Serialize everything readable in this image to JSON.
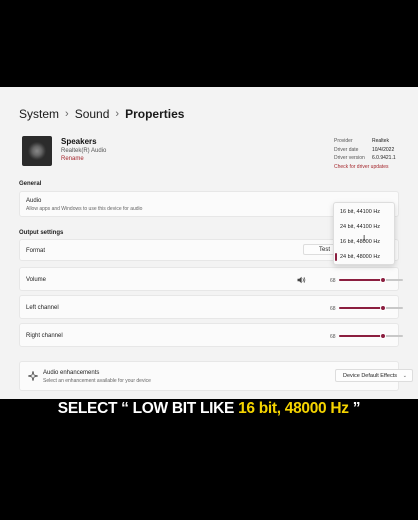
{
  "breadcrumb": {
    "item1": "System",
    "item2": "Sound",
    "current": "Properties"
  },
  "device": {
    "name": "Speakers",
    "subtitle": "Realtek(R) Audio",
    "rename_label": "Rename"
  },
  "info": {
    "provider_label": "Provider",
    "provider_value": "Realtek",
    "date_label": "Driver date",
    "date_value": "10/4/2022",
    "version_label": "Driver version",
    "version_value": "6.0.9421.1",
    "update_link": "Check for driver updates"
  },
  "general": {
    "heading": "General",
    "audio_title": "Audio",
    "audio_desc": "Allow apps and Windows to use this device for audio"
  },
  "output": {
    "heading": "Output settings",
    "format_label": "Format",
    "test_label": "Test",
    "format_options": [
      "16 bit, 44100 Hz",
      "24 bit, 44100 Hz",
      "16 bit, 48000 Hz",
      "24 bit, 48000 Hz"
    ],
    "selected_index": 3,
    "volume_label": "Volume",
    "volume_value": 68,
    "left_label": "Left channel",
    "left_value": 68,
    "right_label": "Right channel",
    "right_value": 68
  },
  "enhancements": {
    "title": "Audio enhancements",
    "desc": "Select an enhancement available for your device",
    "dropdown_value": "Device Default Effects"
  },
  "caption": {
    "part1": "SELECT “ LOW BIT LIKE ",
    "highlight": "16 bit, 48000 Hz",
    "part2": " ”"
  },
  "colors": {
    "accent": "#8b1e3f",
    "link": "#a4262c",
    "highlight": "#f5d400"
  },
  "icons": [
    "device-speaker-icon",
    "speaker-volume-icon",
    "sparkle-icon",
    "chevron-right-icon",
    "chevron-down-icon",
    "cursor-icon"
  ]
}
